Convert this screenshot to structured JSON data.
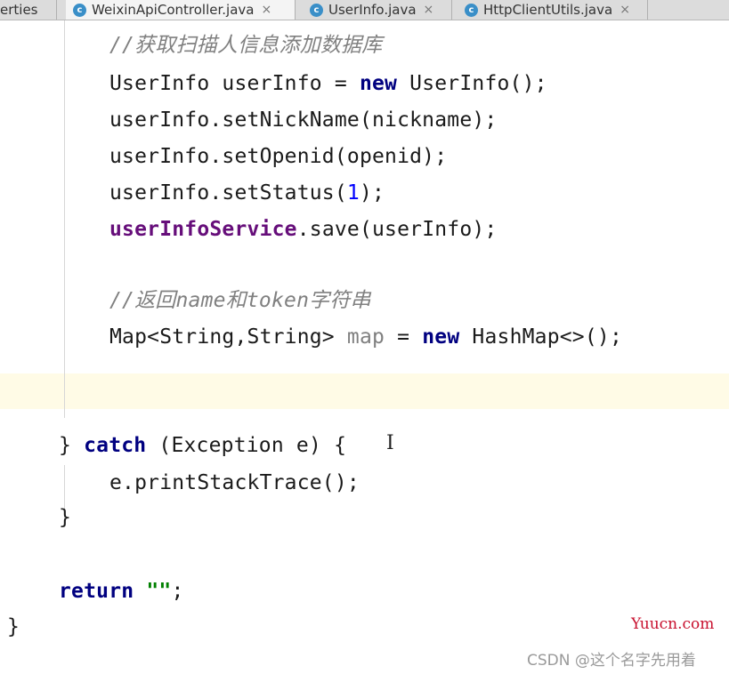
{
  "tabs": [
    {
      "label": "erties",
      "has_icon": false,
      "active": false
    },
    {
      "label": "WeixinApiController.java",
      "has_icon": true,
      "active": true,
      "close": "×"
    },
    {
      "label": "UserInfo.java",
      "has_icon": true,
      "active": false,
      "close": "×"
    },
    {
      "label": "HttpClientUtils.java",
      "has_icon": true,
      "active": false,
      "close": "×"
    }
  ],
  "tab_icon_letter": "c",
  "code": {
    "comment1": "//获取扫描人信息添加数据库",
    "line_userinfo_type": "UserInfo userInfo = ",
    "kw_new": "new",
    "line_userinfo_ctor": " UserInfo();",
    "line_setnick": "userInfo.setNickName(nickname);",
    "line_setopenid": "userInfo.setOpenid(openid);",
    "line_setstatus_pre": "userInfo.setStatus(",
    "line_setstatus_num": "1",
    "line_setstatus_post": ");",
    "line_save_field": "userInfoService",
    "line_save_rest": ".save(userInfo);",
    "comment2": "//返回name和token字符串",
    "line_map_type": "Map<String,String> ",
    "line_map_var": "map",
    "line_map_eq": " = ",
    "line_map_ctor": " HashMap<>();",
    "catch_open": "} ",
    "kw_catch": "catch",
    "catch_rest": " (Exception e) {",
    "line_stack": "e.printStackTrace();",
    "close_brace": "}",
    "kw_return": "return",
    "return_str": " \"\"",
    "return_semi": ";",
    "final_brace": "}"
  },
  "watermark": {
    "site": "Yuucn.com",
    "author": "CSDN @这个名字先用着"
  }
}
